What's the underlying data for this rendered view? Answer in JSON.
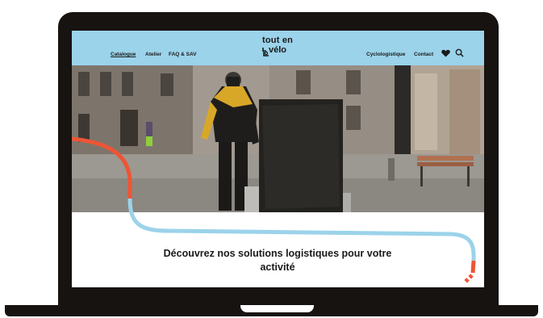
{
  "nav": {
    "left": [
      "Catalogue",
      "Atelier",
      "FAQ & SAV"
    ],
    "right": [
      "Cyclologistique",
      "Contact"
    ]
  },
  "logo": {
    "line1": "tout en",
    "line2": "vélo"
  },
  "icons": {
    "heart": "heart-icon",
    "search": "search-icon",
    "logo_mark": "route-pin-icon"
  },
  "headline": {
    "line1": "Découvrez nos solutions logistiques pour votre",
    "line2": "activité"
  },
  "colors": {
    "header_bg": "#9bd3ea",
    "route_red": "#ee5535",
    "route_blue": "#9bd3ea",
    "frame": "#171310"
  }
}
